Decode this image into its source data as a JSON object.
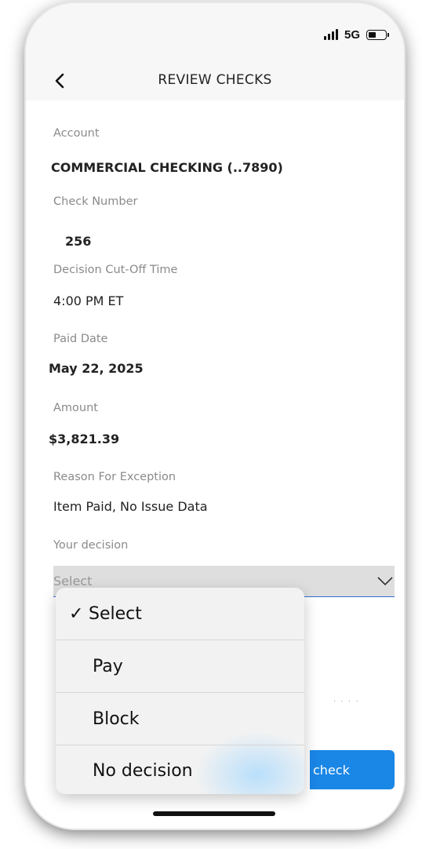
{
  "status_bar": {
    "network": "5G"
  },
  "nav": {
    "title": "REVIEW CHECKS"
  },
  "fields": {
    "account_label": "Account",
    "account_value": "COMMERCIAL CHECKING (..7890)",
    "check_number_label": "Check Number",
    "check_number_value": "256",
    "cutoff_label": "Decision Cut-Off Time",
    "cutoff_value": "4:00 PM ET",
    "paid_date_label": "Paid Date",
    "paid_date_value": "May 22, 2025",
    "amount_label": "Amount",
    "amount_value": "$3,821.39",
    "reason_label": "Reason For Exception",
    "reason_value": "Item Paid, No Issue Data",
    "decision_label": "Your decision",
    "decision_selected": "Select"
  },
  "dropdown": {
    "options": [
      {
        "label": "Select",
        "checked": true
      },
      {
        "label": "Pay",
        "checked": false
      },
      {
        "label": "Block",
        "checked": false
      },
      {
        "label": "No decision",
        "checked": false
      }
    ],
    "check_glyph": "✓"
  },
  "button": {
    "partial_label": "check"
  },
  "colors": {
    "accent": "#1a86e6",
    "underline": "#2f6fd0"
  }
}
